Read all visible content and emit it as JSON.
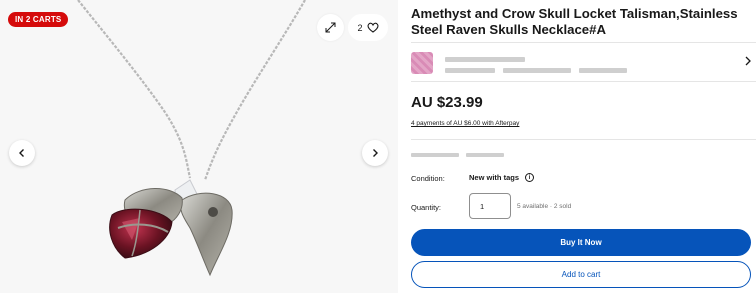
{
  "gallery": {
    "badge": "IN 2 CARTS",
    "watch_count": "2",
    "icons": {
      "expand": "expand-icon",
      "heart": "heart-icon",
      "prev": "chevron-left-icon",
      "next": "chevron-right-icon"
    }
  },
  "listing": {
    "title": "Amethyst and Crow Skull Locket Talisman,Stainless Steel Raven Skulls Necklace#A",
    "price": "AU $23.99",
    "afterpay": "4 payments of AU $6.00 with Afterpay",
    "condition_label": "Condition:",
    "condition_value": "New with tags",
    "quantity_label": "Quantity:",
    "quantity_value": "1",
    "availability": "5 available · 2 sold",
    "buy_label": "Buy It Now",
    "cart_label": "Add to cart"
  },
  "colors": {
    "accent": "#0654ba",
    "badge": "#d50b0b"
  }
}
